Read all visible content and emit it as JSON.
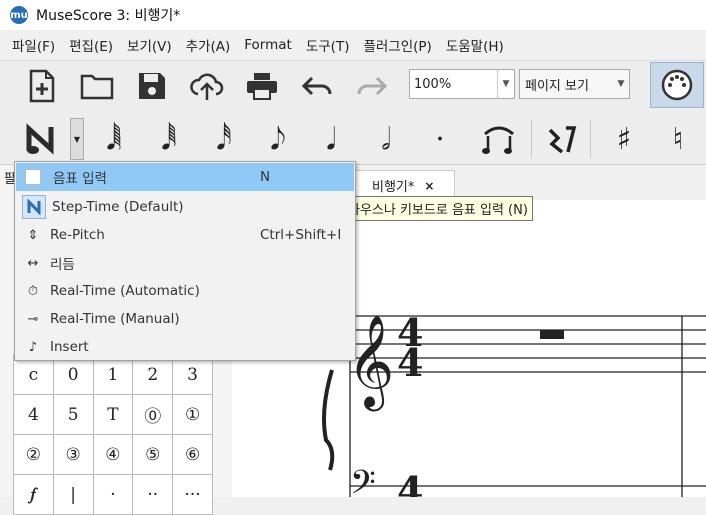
{
  "window": {
    "title": "MuseScore 3: 비행기*",
    "logo_text": "mu"
  },
  "menu": [
    {
      "label": "파일(F)"
    },
    {
      "label": "편집(E)"
    },
    {
      "label": "보기(V)"
    },
    {
      "label": "추가(A)"
    },
    {
      "label": "Format"
    },
    {
      "label": "도구(T)"
    },
    {
      "label": "플러그인(P)"
    },
    {
      "label": "도움말(H)"
    }
  ],
  "toolbar": {
    "zoom_value": "100%",
    "view_mode": "페이지 보기"
  },
  "palette": {
    "header": "팔",
    "grid": [
      [
        "c",
        "0",
        "1",
        "2",
        "3"
      ],
      [
        "4",
        "5",
        "T",
        "⓪",
        "①"
      ],
      [
        "②",
        "③",
        "④",
        "⑤",
        "⑥"
      ],
      [
        "𝆑",
        "|",
        "·",
        "··",
        "···"
      ]
    ]
  },
  "tab": {
    "label": "비행기*",
    "close": "×"
  },
  "tooltip": {
    "text": "마우스나 키보드로 음표 입력 (N)"
  },
  "dropdown": {
    "items": [
      {
        "label": "음표 입력",
        "shortcut": "N",
        "icon": "checkbox"
      },
      {
        "label": "Step-Time (Default)",
        "shortcut": "",
        "icon": "note-n-icon"
      },
      {
        "label": "Re-Pitch",
        "shortcut": "Ctrl+Shift+I",
        "icon": "repitch-icon"
      },
      {
        "label": "리듬",
        "shortcut": "",
        "icon": "rhythm-icon"
      },
      {
        "label": "Real-Time (Automatic)",
        "shortcut": "",
        "icon": "clock-icon"
      },
      {
        "label": "Real-Time (Manual)",
        "shortcut": "",
        "icon": "pedal-icon"
      },
      {
        "label": "Insert",
        "shortcut": "",
        "icon": "insert-icon"
      }
    ]
  },
  "colors": {
    "accent": "#90c8f6",
    "tooltip_bg": "#ffffe1",
    "logo": "#2a6db5"
  }
}
